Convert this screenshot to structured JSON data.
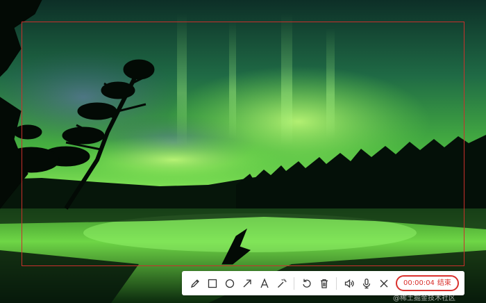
{
  "toolbar": {
    "tools": [
      {
        "name": "pencil-icon"
      },
      {
        "name": "rectangle-icon"
      },
      {
        "name": "circle-icon"
      },
      {
        "name": "arrow-icon"
      },
      {
        "name": "text-icon"
      },
      {
        "name": "magic-wand-icon"
      },
      {
        "name": "undo-icon"
      },
      {
        "name": "trash-icon"
      },
      {
        "name": "speaker-icon"
      },
      {
        "name": "microphone-icon"
      },
      {
        "name": "close-icon"
      }
    ],
    "recording": {
      "time": "00:00:04",
      "end_label": "结束"
    }
  },
  "watermark": "@稀土掘金技术社区",
  "colors": {
    "frame": "#c9302c",
    "record_accent": "#d9302c",
    "icon": "#333333",
    "aurora": "#5ee84a"
  }
}
